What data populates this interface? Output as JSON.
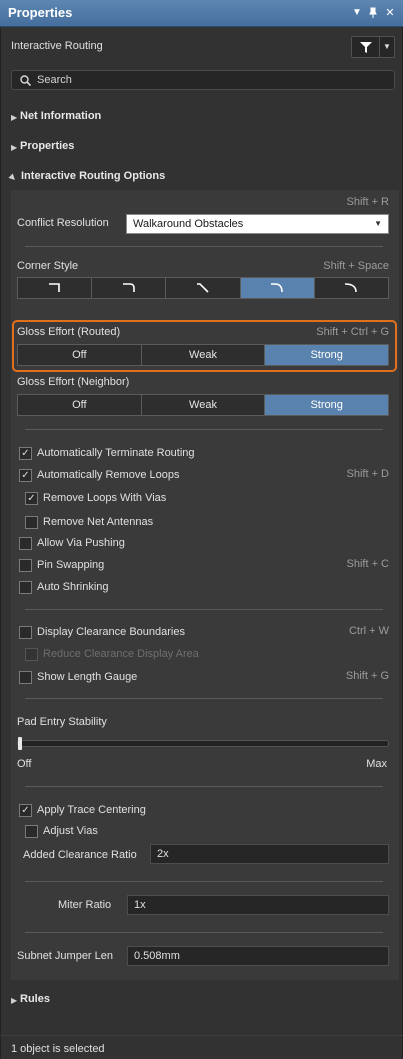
{
  "window": {
    "title": "Properties",
    "controls": [
      "dropdown-icon",
      "pin-icon",
      "close-icon"
    ]
  },
  "header": {
    "object_type": "Interactive Routing",
    "filter_icon": "filter-icon"
  },
  "search": {
    "placeholder": "Search",
    "icon": "search-icon"
  },
  "sections": {
    "net_information": "Net Information",
    "properties": "Properties",
    "interactive_routing_options": "Interactive Routing Options",
    "rules": "Rules"
  },
  "options": {
    "conflict_shortcut": "Shift + R",
    "conflict_label": "Conflict Resolution",
    "conflict_value": "Walkaround Obstacles",
    "corner_label": "Corner Style",
    "corner_shortcut": "Shift + Space",
    "corner_styles": [
      "corner-90-icon",
      "corner-90-arc-icon",
      "corner-45-icon",
      "corner-rounded-icon",
      "corner-any-arc-icon"
    ],
    "corner_selected": 3,
    "gloss_routed_label": "Gloss Effort (Routed)",
    "gloss_routed_shortcut": "Shift + Ctrl + G",
    "gloss_routed_options": [
      "Off",
      "Weak",
      "Strong"
    ],
    "gloss_routed_selected": "Strong",
    "gloss_neighbor_label": "Gloss Effort (Neighbor)",
    "gloss_neighbor_options": [
      "Off",
      "Weak",
      "Strong"
    ],
    "gloss_neighbor_selected": "Strong"
  },
  "checks": {
    "auto_terminate": {
      "label": "Automatically Terminate Routing",
      "checked": true
    },
    "auto_remove_loops": {
      "label": "Automatically Remove Loops",
      "checked": true,
      "shortcut": "Shift + D"
    },
    "remove_loops_vias": {
      "label": "Remove Loops With Vias",
      "checked": true
    },
    "remove_net_antennas": {
      "label": "Remove Net Antennas",
      "checked": false
    },
    "allow_via_pushing": {
      "label": "Allow Via Pushing",
      "checked": false
    },
    "pin_swapping": {
      "label": "Pin Swapping",
      "checked": false,
      "shortcut": "Shift + C"
    },
    "auto_shrinking": {
      "label": "Auto Shrinking",
      "checked": false
    },
    "display_clearance": {
      "label": "Display Clearance Boundaries",
      "checked": false,
      "shortcut": "Ctrl + W"
    },
    "reduce_clearance": {
      "label": "Reduce Clearance Display Area",
      "checked": false,
      "disabled": true
    },
    "show_length_gauge": {
      "label": "Show Length Gauge",
      "checked": false,
      "shortcut": "Shift + G"
    },
    "apply_trace_centering": {
      "label": "Apply Trace Centering",
      "checked": true
    },
    "adjust_vias": {
      "label": "Adjust Vias",
      "checked": false
    }
  },
  "pad_entry": {
    "label": "Pad Entry Stability",
    "min_label": "Off",
    "max_label": "Max",
    "level": 0
  },
  "fields": {
    "added_clearance_label": "Added Clearance Ratio",
    "added_clearance_value": "2x",
    "miter_label": "Miter Ratio",
    "miter_value": "1x",
    "subnet_label": "Subnet Jumper Len",
    "subnet_value": "0.508mm"
  },
  "status": {
    "text": "1 object is selected"
  },
  "colors": {
    "accent": "#5a82ae",
    "highlight": "#e0701c",
    "title_bar": "#4f78a6"
  }
}
